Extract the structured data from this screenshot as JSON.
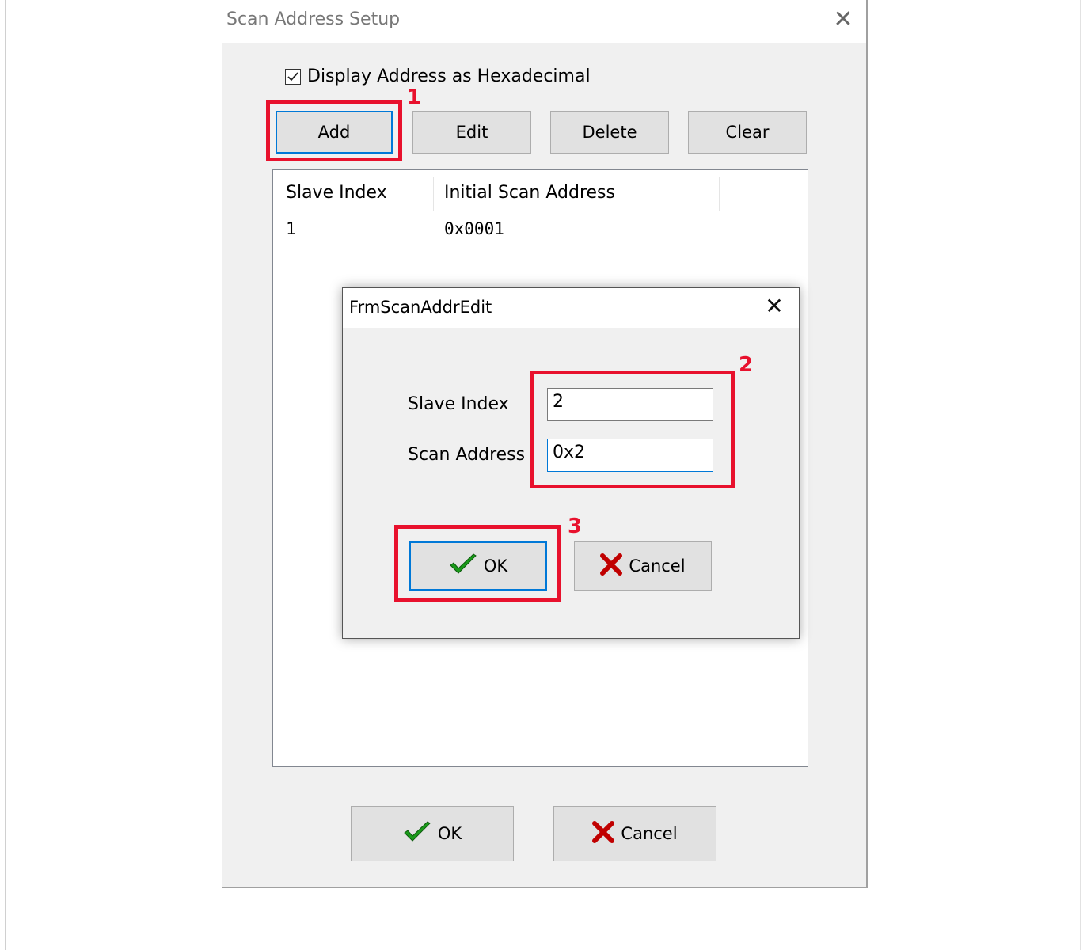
{
  "main_dialog": {
    "title": "Scan Address Setup",
    "hex_checkbox": {
      "label": "Display Address as Hexadecimal",
      "checked": true
    },
    "buttons": {
      "add": "Add",
      "edit": "Edit",
      "delete": "Delete",
      "clear": "Clear"
    },
    "list": {
      "columns": [
        "Slave Index",
        "Initial Scan Address"
      ],
      "rows": [
        {
          "slave_index": "1",
          "scan_address": "0x0001"
        }
      ]
    },
    "footer": {
      "ok": "OK",
      "cancel": "Cancel"
    }
  },
  "edit_dialog": {
    "title": "FrmScanAddrEdit",
    "slave_index_label": "Slave Index",
    "slave_index_value": "2",
    "scan_address_label": "Scan Address",
    "scan_address_value": "0x2",
    "ok": "OK",
    "cancel": "Cancel"
  },
  "annotations": {
    "step1": "1",
    "step2": "2",
    "step3": "3"
  },
  "colors": {
    "annotation": "#e8112d",
    "focus": "#0078d7",
    "check_icon": "#1a9a1a",
    "cancel_icon": "#c00000"
  }
}
